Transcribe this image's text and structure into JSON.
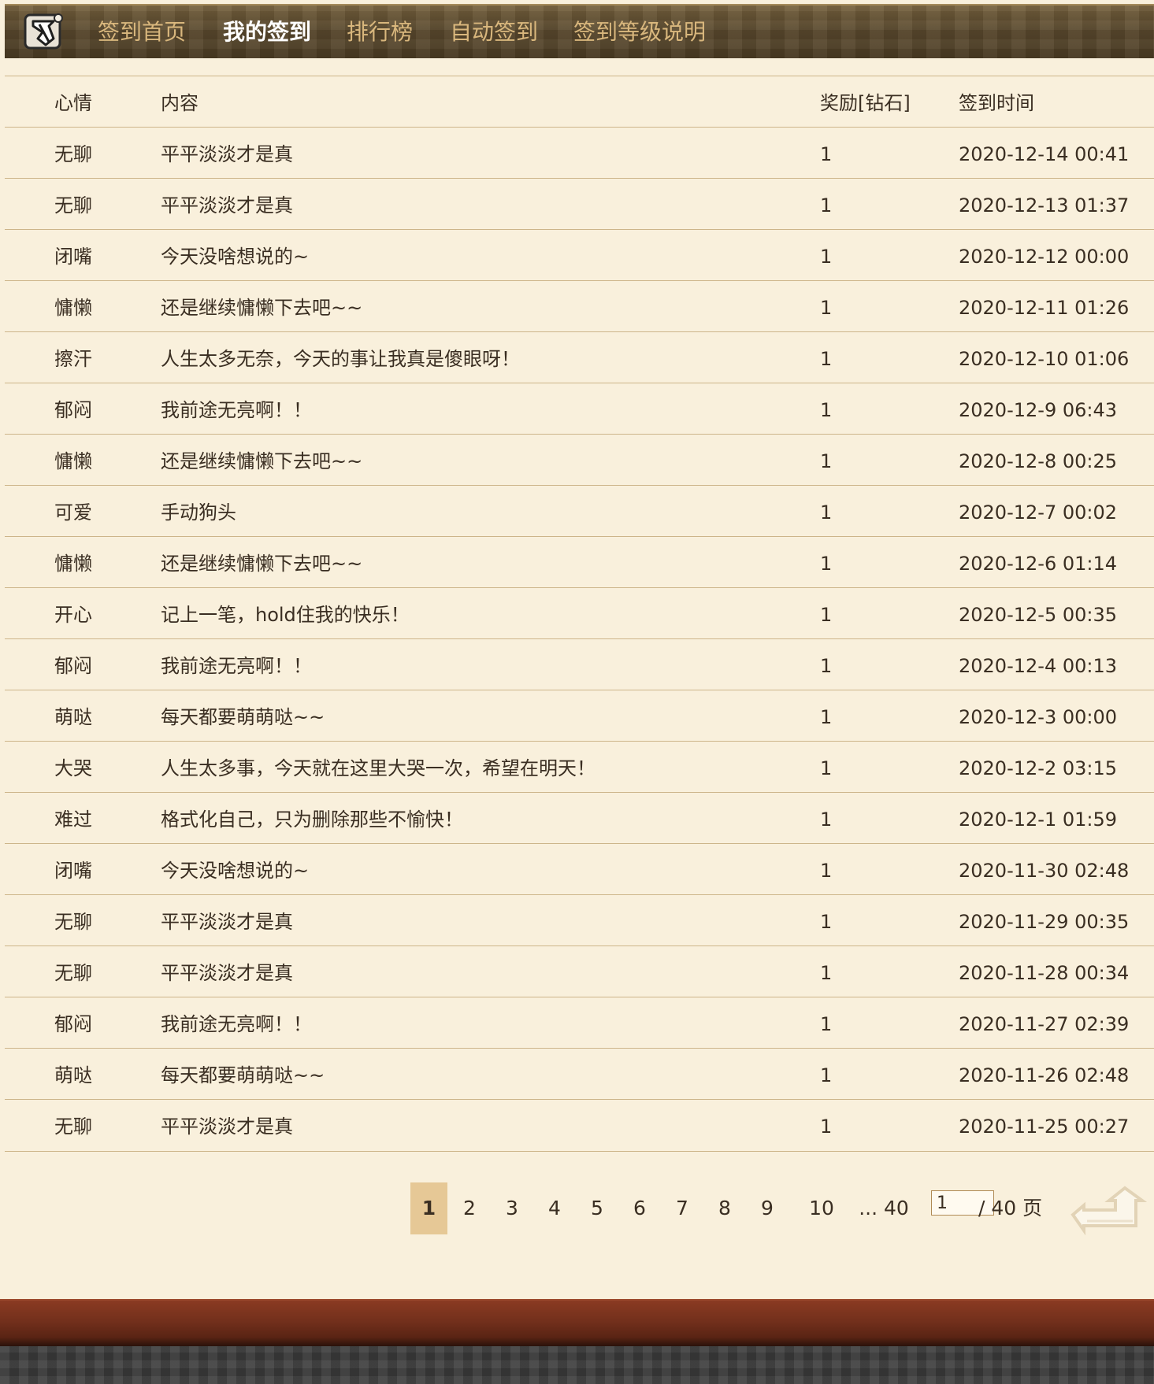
{
  "nav": {
    "items": [
      {
        "label": "签到首页"
      },
      {
        "label": "我的签到"
      },
      {
        "label": "排行榜"
      },
      {
        "label": "自动签到"
      },
      {
        "label": "签到等级说明"
      }
    ],
    "active_index": 1
  },
  "table": {
    "headers": {
      "mood": "心情",
      "content": "内容",
      "reward": "奖励[钻石]",
      "time": "签到时间"
    },
    "rows": [
      {
        "mood": "无聊",
        "content": "平平淡淡才是真",
        "reward": "1",
        "time": "2020-12-14 00:41"
      },
      {
        "mood": "无聊",
        "content": "平平淡淡才是真",
        "reward": "1",
        "time": "2020-12-13 01:37"
      },
      {
        "mood": "闭嘴",
        "content": "今天没啥想说的~",
        "reward": "1",
        "time": "2020-12-12 00:00"
      },
      {
        "mood": "慵懒",
        "content": "还是继续慵懒下去吧~~",
        "reward": "1",
        "time": "2020-12-11 01:26"
      },
      {
        "mood": "擦汗",
        "content": "人生太多无奈，今天的事让我真是傻眼呀！",
        "reward": "1",
        "time": "2020-12-10 01:06"
      },
      {
        "mood": "郁闷",
        "content": "我前途无亮啊！！",
        "reward": "1",
        "time": "2020-12-9 06:43"
      },
      {
        "mood": "慵懒",
        "content": "还是继续慵懒下去吧~~",
        "reward": "1",
        "time": "2020-12-8 00:25"
      },
      {
        "mood": "可爱",
        "content": "手动狗头",
        "reward": "1",
        "time": "2020-12-7 00:02"
      },
      {
        "mood": "慵懒",
        "content": "还是继续慵懒下去吧~~",
        "reward": "1",
        "time": "2020-12-6 01:14"
      },
      {
        "mood": "开心",
        "content": "记上一笔，hold住我的快乐！",
        "reward": "1",
        "time": "2020-12-5 00:35"
      },
      {
        "mood": "郁闷",
        "content": "我前途无亮啊！！",
        "reward": "1",
        "time": "2020-12-4 00:13"
      },
      {
        "mood": "萌哒",
        "content": "每天都要萌萌哒~~",
        "reward": "1",
        "time": "2020-12-3 00:00"
      },
      {
        "mood": "大哭",
        "content": "人生太多事，今天就在这里大哭一次，希望在明天！",
        "reward": "1",
        "time": "2020-12-2 03:15"
      },
      {
        "mood": "难过",
        "content": "格式化自己，只为删除那些不愉快！",
        "reward": "1",
        "time": "2020-12-1 01:59"
      },
      {
        "mood": "闭嘴",
        "content": "今天没啥想说的~",
        "reward": "1",
        "time": "2020-11-30 02:48"
      },
      {
        "mood": "无聊",
        "content": "平平淡淡才是真",
        "reward": "1",
        "time": "2020-11-29 00:35"
      },
      {
        "mood": "无聊",
        "content": "平平淡淡才是真",
        "reward": "1",
        "time": "2020-11-28 00:34"
      },
      {
        "mood": "郁闷",
        "content": "我前途无亮啊！！",
        "reward": "1",
        "time": "2020-11-27 02:39"
      },
      {
        "mood": "萌哒",
        "content": "每天都要萌萌哒~~",
        "reward": "1",
        "time": "2020-11-26 02:48"
      },
      {
        "mood": "无聊",
        "content": "平平淡淡才是真",
        "reward": "1",
        "time": "2020-11-25 00:27"
      }
    ]
  },
  "pagination": {
    "pages": [
      "1",
      "2",
      "3",
      "4",
      "5",
      "6",
      "7",
      "8",
      "9",
      "10",
      "... 40"
    ],
    "current": "1",
    "input_value": "1",
    "total_label": "/ 40 页"
  },
  "icons": {
    "logo": "site-logo-icon",
    "go": "go-arrow-icon"
  },
  "colors": {
    "background": "#f9f0dc",
    "nav_text": "#d9b77d",
    "nav_active": "#ffffff",
    "row_border": "#cdb58a",
    "current_page_bg": "#e6c896",
    "footer_red": "#73301c"
  }
}
